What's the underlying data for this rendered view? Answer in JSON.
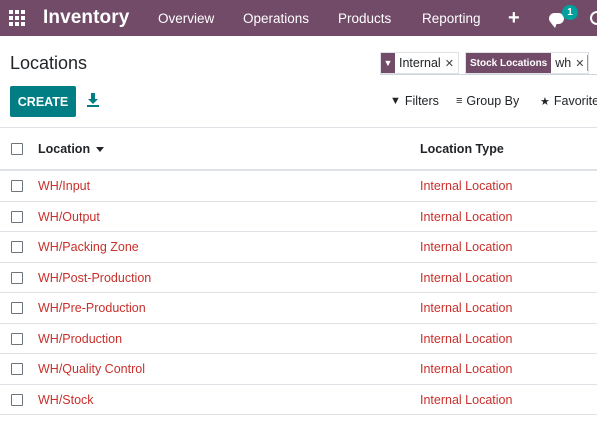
{
  "navbar": {
    "app_name": "Inventory",
    "menu": [
      "Overview",
      "Operations",
      "Products",
      "Reporting"
    ],
    "add_icon": "plus-icon",
    "chat_icon": "chat-icon",
    "chat_badge": "1",
    "bg_color": "#714b67"
  },
  "control": {
    "title": "Locations",
    "facets": [
      {
        "icon": "filter-icon",
        "value": "Internal"
      },
      {
        "label": "Stock Locations",
        "value": "wh"
      }
    ],
    "create_label": "CREATE",
    "download_icon": "download-icon",
    "filters_label": "Filters",
    "groupby_label": "Group By",
    "favorites_label": "Favorite"
  },
  "list": {
    "columns": [
      "Location",
      "Location Type"
    ],
    "sort_icon": "caret-down-icon",
    "rows": [
      {
        "location": "WH/Input",
        "type": "Internal Location"
      },
      {
        "location": "WH/Output",
        "type": "Internal Location"
      },
      {
        "location": "WH/Packing Zone",
        "type": "Internal Location"
      },
      {
        "location": "WH/Post-Production",
        "type": "Internal Location"
      },
      {
        "location": "WH/Pre-Production",
        "type": "Internal Location"
      },
      {
        "location": "WH/Production",
        "type": "Internal Location"
      },
      {
        "location": "WH/Quality Control",
        "type": "Internal Location"
      },
      {
        "location": "WH/Stock",
        "type": "Internal Location"
      }
    ],
    "link_color": "#c9302c",
    "accent_color": "#017e84"
  }
}
